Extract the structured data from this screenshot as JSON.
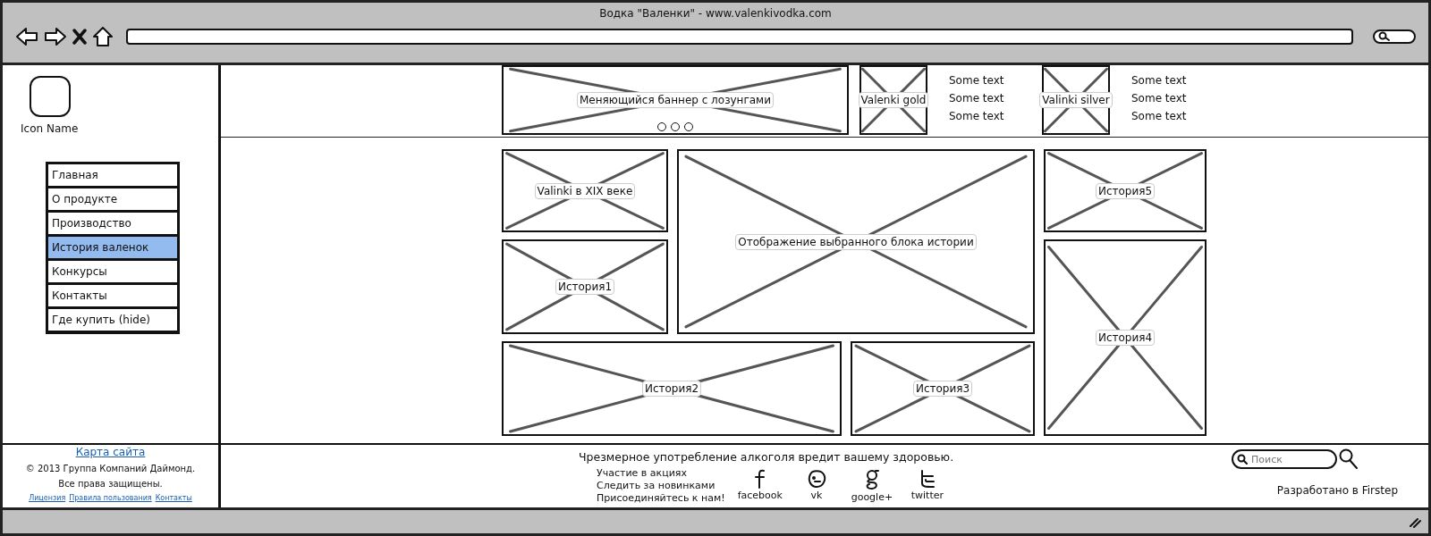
{
  "window": {
    "title": "Водка \"Валенки\" - www.valenkivodka.com"
  },
  "sidebar": {
    "icon_label": "Icon Name",
    "menu": [
      {
        "label": "Главная",
        "selected": false
      },
      {
        "label": "О продукте",
        "selected": false
      },
      {
        "label": "Производство",
        "selected": false
      },
      {
        "label": "История валенок",
        "selected": true
      },
      {
        "label": "Конкурсы",
        "selected": false
      },
      {
        "label": "Контакты",
        "selected": false
      },
      {
        "label": "Где купить (hide)",
        "selected": false
      }
    ]
  },
  "banner": {
    "label": "Меняющийся баннер с лозунгами"
  },
  "products": [
    {
      "label": "Valenki gold",
      "texts": [
        "Some text",
        "Some text",
        "Some text"
      ]
    },
    {
      "label": "Valinki silver",
      "texts": [
        "Some text",
        "Some text",
        "Some text"
      ]
    }
  ],
  "stories": [
    {
      "label": "Valinki в XIX веке"
    },
    {
      "label": "Отображение выбранного блока истории"
    },
    {
      "label": "История5"
    },
    {
      "label": "История1"
    },
    {
      "label": "История4"
    },
    {
      "label": "История2"
    },
    {
      "label": "История3"
    }
  ],
  "footer": {
    "sitemap": "Карта сайта",
    "copyright": [
      "© 2013 Группа Компаний Даймонд.",
      "Все права защищены."
    ],
    "links": [
      "Лицензия",
      "Правила пользования",
      "Контакты"
    ],
    "warning": "Чрезмерное употребление алкоголя вредит вашему здоровью.",
    "actions": [
      "Участие в акциях",
      "Следить за новинками",
      "Присоединяйтесь к нам!"
    ],
    "social": [
      {
        "kind": "facebook",
        "label": "facebook"
      },
      {
        "kind": "vk",
        "label": "vk"
      },
      {
        "kind": "google",
        "label": "google+"
      },
      {
        "kind": "twitter",
        "label": "twitter"
      }
    ],
    "search": {
      "placeholder": "Поиск"
    },
    "credit": "Разработано в Firstep"
  }
}
